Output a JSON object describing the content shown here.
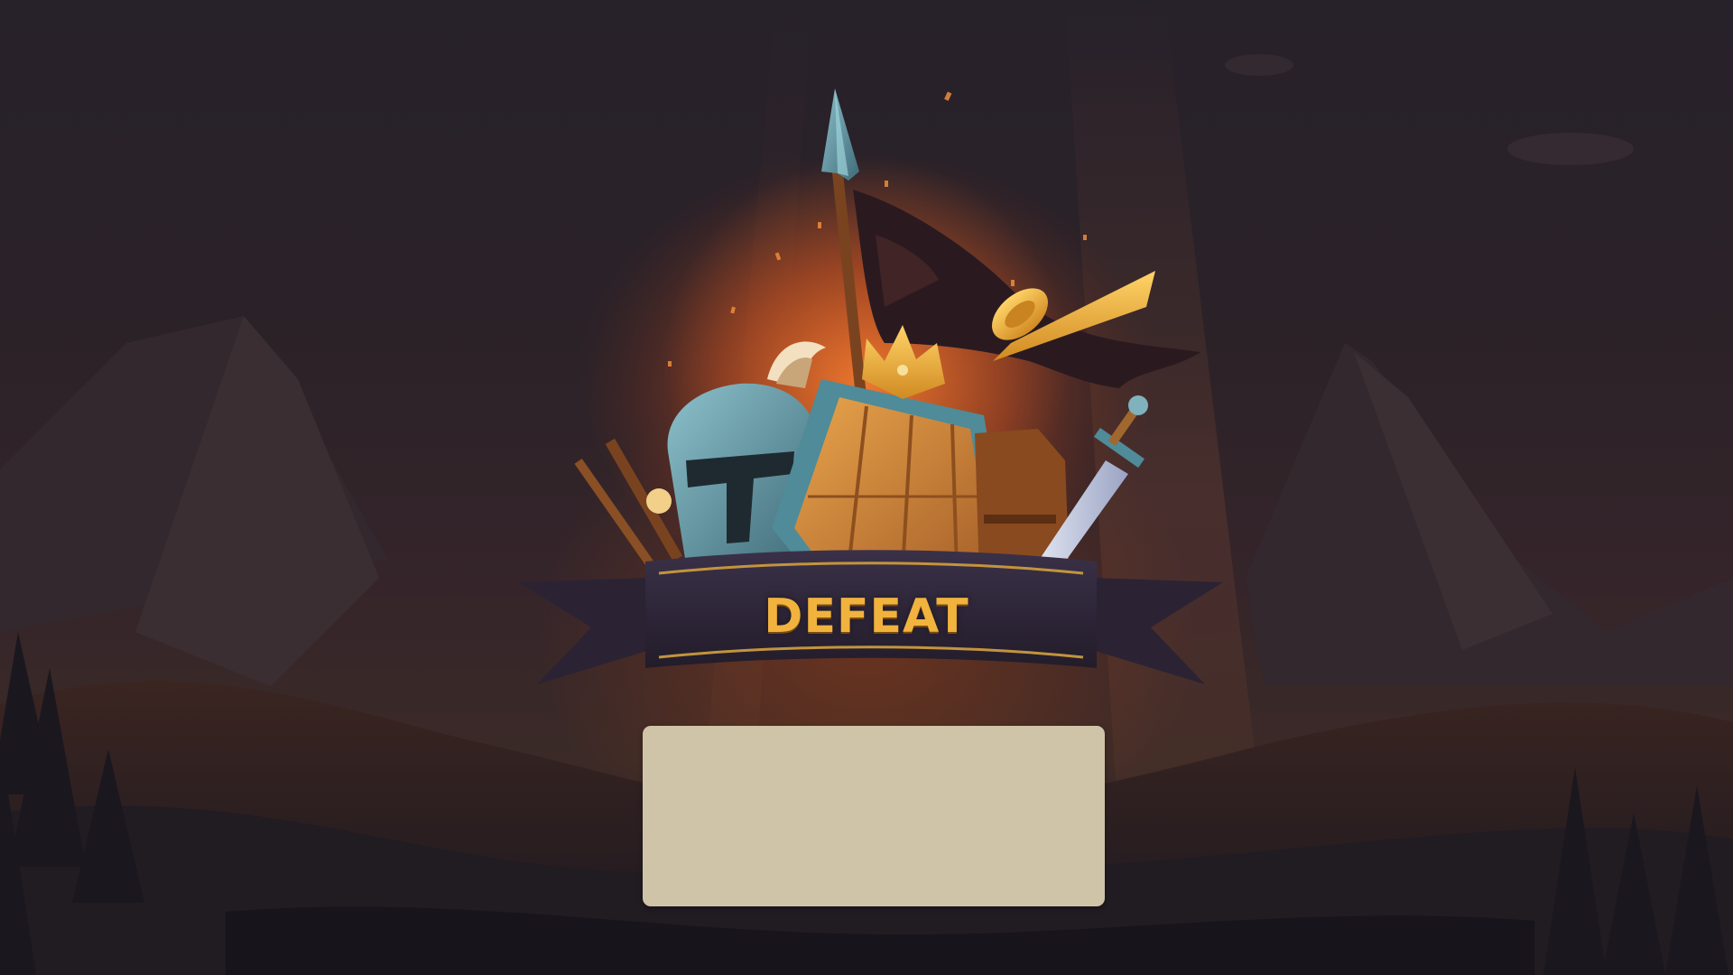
{
  "screen": {
    "name": "battle-result",
    "result_title": "DEFEAT"
  },
  "emblem": {
    "items": [
      "spear-icon",
      "tattered-flag-icon",
      "horned-helmet-icon",
      "wooden-shield-icon",
      "crown-icon",
      "horn-icon",
      "sword-icon",
      "wooden-staff-icon"
    ]
  },
  "colors": {
    "title_gold": "#f1b33e",
    "banner_purple": "#2c2436",
    "panel_beige": "#cfc3a8",
    "glow_orange": "#e0642a",
    "steel_blue": "#6fa7b5"
  }
}
